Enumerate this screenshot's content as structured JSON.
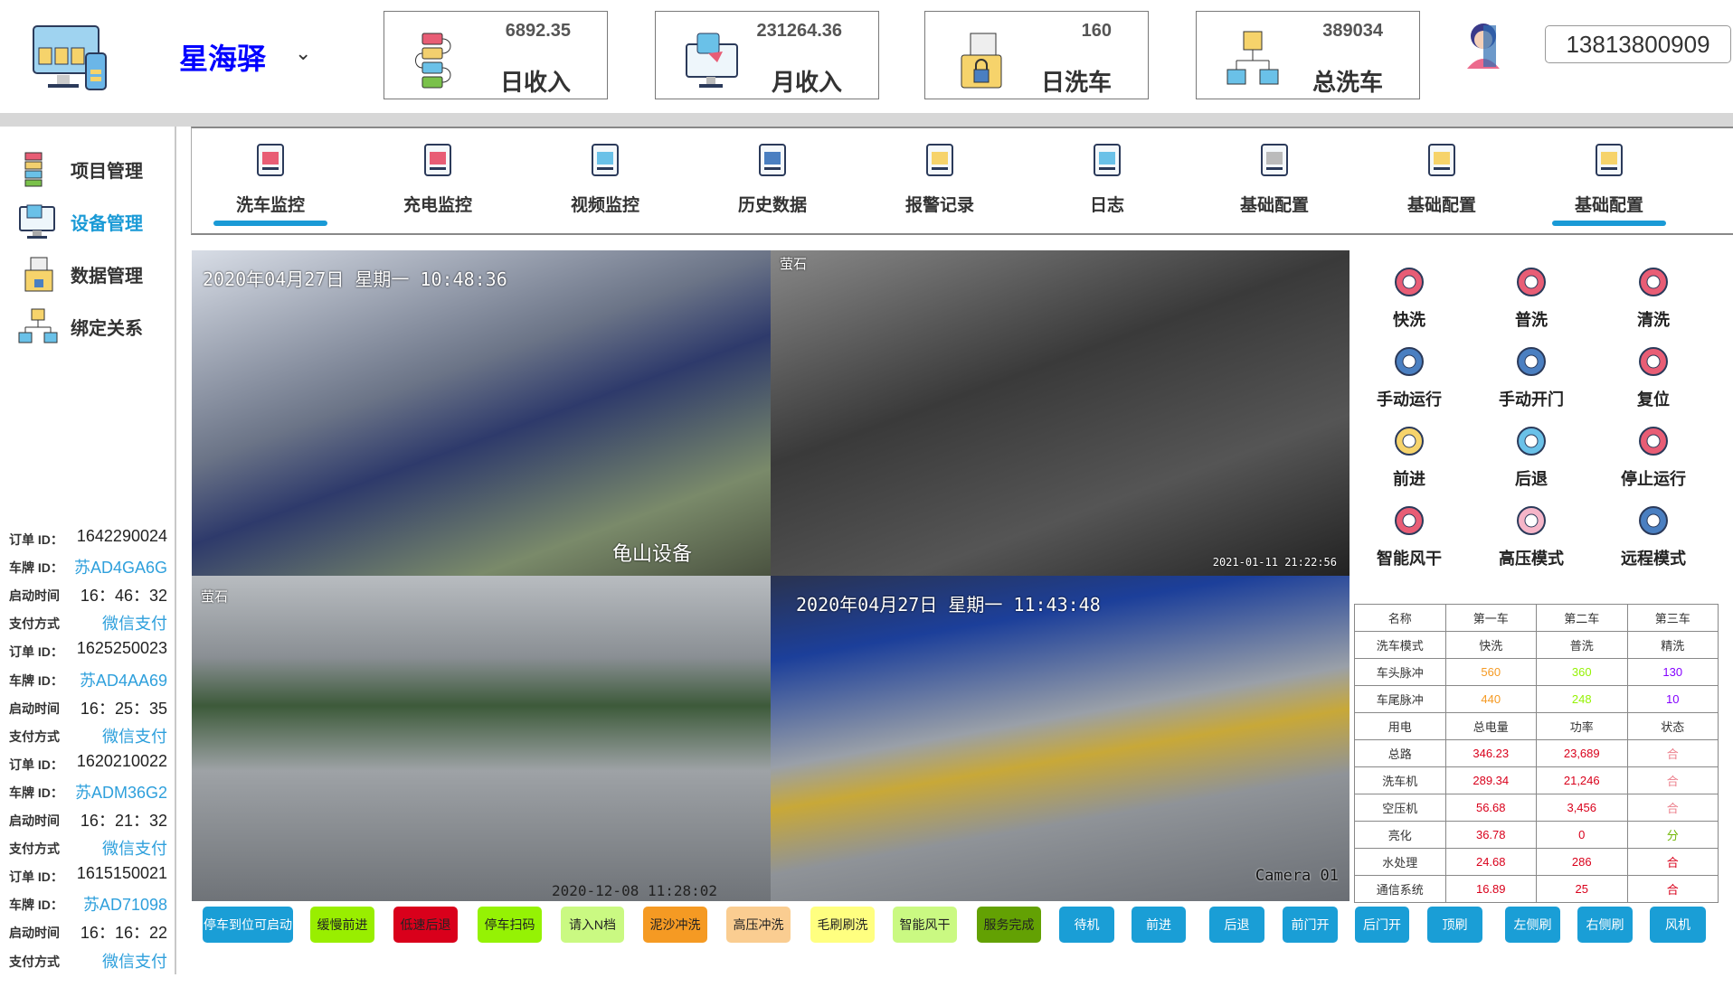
{
  "header": {
    "brand": "星海驿",
    "chevron": "chevron-down-icon",
    "phone": "13813800909",
    "stats": [
      {
        "value": "6892.35",
        "label": "日收入",
        "icon": "workflow-icon"
      },
      {
        "value": "231264.36",
        "label": "月收入",
        "icon": "monitor-chat-icon"
      },
      {
        "value": "160",
        "label": "日洗车",
        "icon": "locked-folder-icon"
      },
      {
        "value": "389034",
        "label": "总洗车",
        "icon": "network-computers-icon"
      }
    ]
  },
  "sidebar": {
    "items": [
      {
        "label": "项目管理",
        "icon": "workflow-icon"
      },
      {
        "label": "设备管理",
        "icon": "monitor-icon",
        "active": true
      },
      {
        "label": "数据管理",
        "icon": "locked-folder-icon"
      },
      {
        "label": "绑定关系",
        "icon": "network-icon"
      }
    ],
    "labels": {
      "order": "订单 ID：",
      "plate": "车牌 ID：",
      "start": "启动时间",
      "pay": "支付方式"
    },
    "orders": [
      {
        "order": "1642290024",
        "plate": "苏AD4GA6G",
        "start": "16：46：32",
        "pay": "微信支付"
      },
      {
        "order": "1625250023",
        "plate": "苏AD4AA69",
        "start": "16：25：35",
        "pay": "微信支付"
      },
      {
        "order": "1620210022",
        "plate": "苏ADM36G2",
        "start": "16：21：32",
        "pay": "微信支付"
      },
      {
        "order": "1615150021",
        "plate": "苏AD71098",
        "start": "16：16：22",
        "pay": "微信支付"
      }
    ]
  },
  "tabs": [
    {
      "label": "洗车监控",
      "active": true
    },
    {
      "label": "充电监控"
    },
    {
      "label": "视频监控"
    },
    {
      "label": "历史数据"
    },
    {
      "label": "报警记录"
    },
    {
      "label": "日志"
    },
    {
      "label": "基础配置"
    },
    {
      "label": "基础配置"
    },
    {
      "label": "基础配置",
      "active": true
    }
  ],
  "videos": [
    {
      "ts": "2020年04月27日 星期一 10:48:36",
      "caption": "龟山设备"
    },
    {
      "logo": "萤石",
      "ts": "2021-01-11 21:22:56"
    },
    {
      "logo": "萤石",
      "ts": "2020-12-08 11:28:02"
    },
    {
      "ts": "2020年04月27日 星期一 11:43:48",
      "caption": "Camera 01"
    }
  ],
  "controls": [
    {
      "label": "快洗",
      "icon": "car-wifi-icon"
    },
    {
      "label": "普洗",
      "icon": "eco-car-icon"
    },
    {
      "label": "清洗",
      "icon": "car-remote-icon"
    },
    {
      "label": "手动运行",
      "icon": "wind-turbine-icon"
    },
    {
      "label": "手动开门",
      "icon": "power-chart-icon"
    },
    {
      "label": "复位",
      "icon": "gear-icon"
    },
    {
      "label": "前进",
      "icon": "clock-arrow-icon"
    },
    {
      "label": "后退",
      "icon": "windmill-icon"
    },
    {
      "label": "停止运行",
      "icon": "chip-cycle-icon"
    },
    {
      "label": "智能风干",
      "icon": "antenna-tower-icon"
    },
    {
      "label": "高压模式",
      "icon": "fingerprint-touch-icon"
    },
    {
      "label": "远程模式",
      "icon": "traffic-light-icon"
    }
  ],
  "table": {
    "rows": [
      [
        "名称",
        "第一车",
        "第二车",
        "第三车"
      ],
      [
        "洗车模式",
        "快洗",
        "普洗",
        "精洗"
      ],
      [
        "车头脉冲",
        "560",
        "360",
        "130"
      ],
      [
        "车尾脉冲",
        "440",
        "248",
        "10"
      ],
      [
        "用电",
        "总电量",
        "功率",
        "状态"
      ],
      [
        "总路",
        "346.23",
        "23,689",
        "合"
      ],
      [
        "洗车机",
        "289.34",
        "21,246",
        "合"
      ],
      [
        "空压机",
        "56.68",
        "3,456",
        "合"
      ],
      [
        "亮化",
        "36.78",
        "0",
        "分"
      ],
      [
        "水处理",
        "24.68",
        "286",
        "合"
      ],
      [
        "通信系统",
        "16.89",
        "25",
        "合"
      ]
    ],
    "colors": {
      "orange": "#f59a23",
      "green": "#95f204",
      "purple": "#8400ff",
      "red": "#d9001b",
      "pink": "#ec808d",
      "okgreen": "#70b603"
    }
  },
  "buttons": [
    {
      "label": "停车到位可启动",
      "color": "#1a9ed6"
    },
    {
      "label": "缓慢前进",
      "color": "#99ee00"
    },
    {
      "label": "低速后退",
      "color": "#d9001b"
    },
    {
      "label": "停车扫码",
      "color": "#95f204"
    },
    {
      "label": "请入N档",
      "color": "#caf982"
    },
    {
      "label": "泥沙冲洗",
      "color": "#f59a23"
    },
    {
      "label": "高压冲洗",
      "color": "#facd91"
    },
    {
      "label": "毛刷刷洗",
      "color": "#ffff80"
    },
    {
      "label": "智能风干",
      "color": "#caf982"
    },
    {
      "label": "服务完成",
      "color": "#63a103"
    },
    {
      "label": "待机",
      "color": "#1a9ed6"
    },
    {
      "label": "前进",
      "color": "#1a9ed6"
    },
    {
      "label": "后退",
      "color": "#1a9ed6"
    },
    {
      "label": "前门开",
      "color": "#1a9ed6"
    },
    {
      "label": "后门开",
      "color": "#1a9ed6"
    },
    {
      "label": "顶刷",
      "color": "#1a9ed6"
    },
    {
      "label": "左侧刷",
      "color": "#1a9ed6"
    },
    {
      "label": "右侧刷",
      "color": "#1a9ed6"
    },
    {
      "label": "风机",
      "color": "#1a9ed6"
    }
  ]
}
